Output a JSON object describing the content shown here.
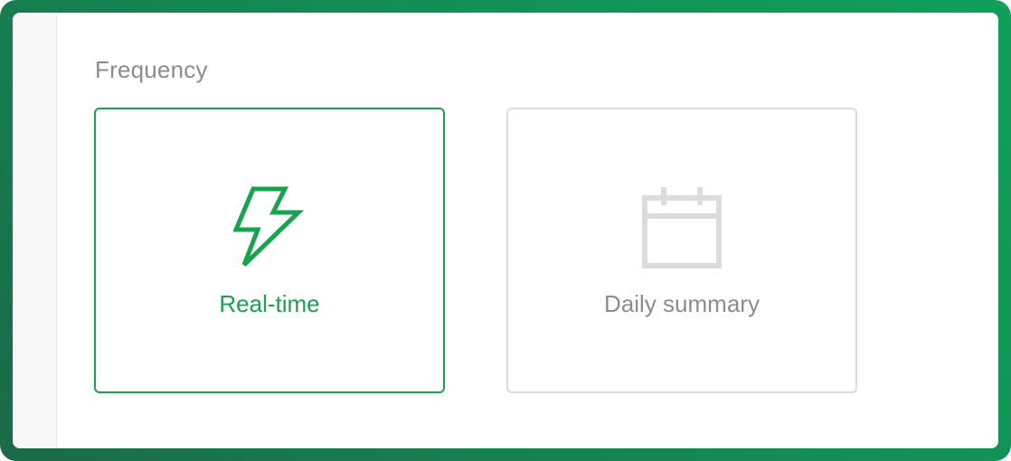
{
  "frequency": {
    "label": "Frequency",
    "options": [
      {
        "label": "Real-time",
        "icon": "lightning-bolt-icon",
        "selected": true
      },
      {
        "label": "Daily summary",
        "icon": "calendar-icon",
        "selected": false
      }
    ]
  },
  "colors": {
    "accent": "#18a34f",
    "muted_text": "#8c8c8c",
    "border_muted": "#dcdcdc",
    "frame_gradient_start": "#1a6a47",
    "frame_gradient_end": "#10a05a"
  }
}
